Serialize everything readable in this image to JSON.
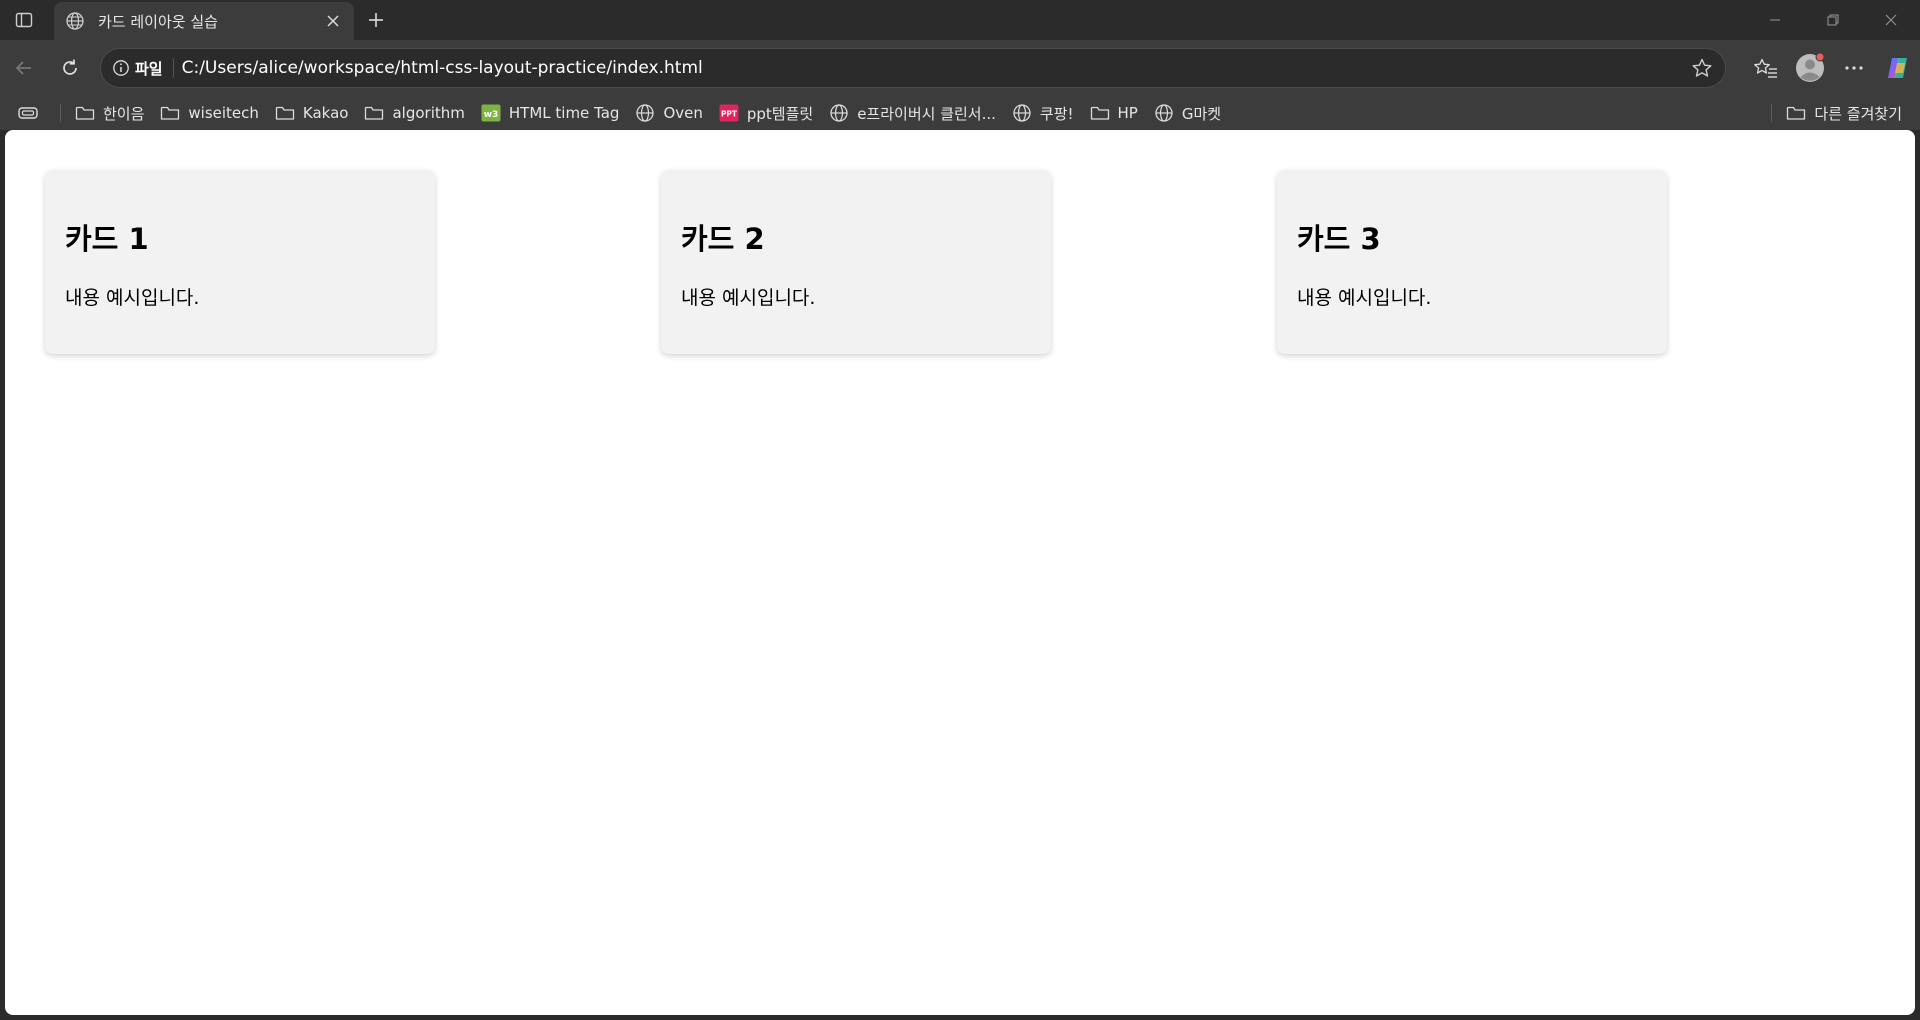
{
  "browser": {
    "tab": {
      "title": "카드 레이아웃 실습"
    },
    "address": {
      "scheme_label": "파일",
      "url": "C:/Users/alice/workspace/html-css-layout-practice/index.html"
    },
    "bookmarks": [
      {
        "label": "한이음",
        "icon": "folder-icon"
      },
      {
        "label": "wiseitech",
        "icon": "folder-icon"
      },
      {
        "label": "Kakao",
        "icon": "folder-icon"
      },
      {
        "label": "algorithm",
        "icon": "folder-icon"
      },
      {
        "label": "HTML time Tag",
        "icon": "w3-icon"
      },
      {
        "label": "Oven",
        "icon": "globe-icon"
      },
      {
        "label": "ppt템플릿",
        "icon": "ppt-icon"
      },
      {
        "label": "e프라이버시 클린서...",
        "icon": "globe-icon"
      },
      {
        "label": "쿠팡!",
        "icon": "globe-icon"
      },
      {
        "label": "HP",
        "icon": "folder-icon"
      },
      {
        "label": "G마켓",
        "icon": "globe-icon"
      }
    ],
    "other_bookmarks": "다른 즐겨찾기",
    "colors": {
      "chrome_dark": "#2b2b2b",
      "chrome": "#3c3c3c",
      "card_bg": "#f2f2f2"
    }
  },
  "page": {
    "cards": [
      {
        "title": "카드 1",
        "body": "내용 예시입니다."
      },
      {
        "title": "카드 2",
        "body": "내용 예시입니다."
      },
      {
        "title": "카드 3",
        "body": "내용 예시입니다."
      }
    ]
  }
}
